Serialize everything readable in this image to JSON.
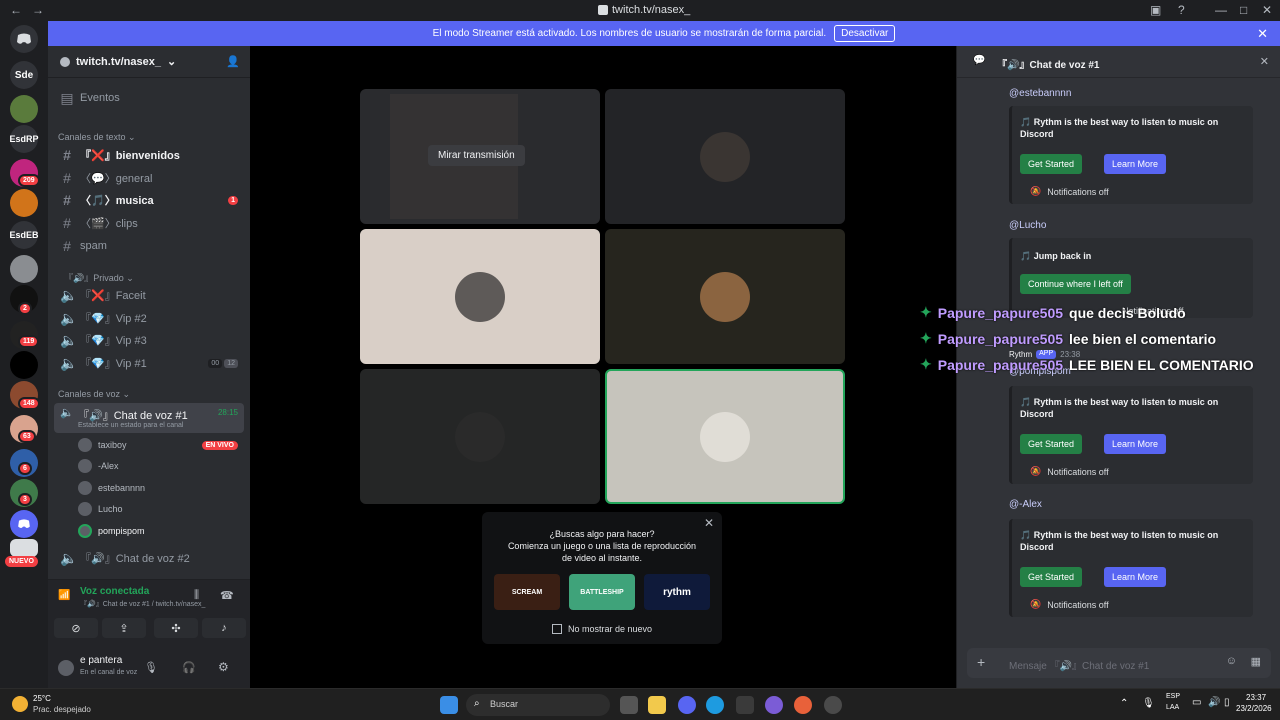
{
  "browser": {
    "title": "twitch.tv/nasex_"
  },
  "guilds": {
    "sde": "Sde",
    "esdrp": "EsdRP",
    "esdeb": "EsdEB",
    "badges": [
      "209",
      "2",
      "119",
      "148",
      "63",
      "6",
      "3"
    ],
    "new_label": "NUEVO"
  },
  "banner": {
    "text": "El modo Streamer está activado. Los nombres de usuario se mostrarán de forma parcial.",
    "button": "Desactivar"
  },
  "server": {
    "name": "twitch.tv/nasex_"
  },
  "sidebar": {
    "events": "Eventos",
    "text_category": "Canales de texto",
    "text_channels": [
      {
        "label": "『❌』bienvenidos"
      },
      {
        "label": "〈💬〉general"
      },
      {
        "label": "〈🎵〉musica",
        "badge": "1"
      },
      {
        "label": "〈🎬〉clips"
      },
      {
        "label": "spam"
      }
    ],
    "private_category": "『🔊』Privado",
    "private_channels": [
      "『❌』Faceit",
      "『💎』Vip #2",
      "『💎』Vip #3",
      "『💎』Vip #1"
    ],
    "vip1_counts": [
      "00",
      "12"
    ],
    "voice_category": "Canales de voz",
    "voice_channel": {
      "label": "『🔊』Chat de voz #1",
      "time": "28:15",
      "status": "Establece un estado para el canal"
    },
    "voice_users": [
      {
        "name": "taxiboy",
        "live": "EN VIVO"
      },
      {
        "name": "-Alex"
      },
      {
        "name": "estebannnn"
      },
      {
        "name": "Lucho"
      },
      {
        "name": "pompispom"
      }
    ],
    "voice_channel2": "『🔊』Chat de voz #2",
    "voice_connected": "Voz conectada",
    "voice_location": "『🔊』Chat de voz #1 / twitch.tv/nasex_",
    "user_name": "e pantera",
    "user_status": "En el canal de voz"
  },
  "stage": {
    "watch_button": "Mirar transmisión",
    "popup_title": "¿Buscas algo para hacer?",
    "popup_sub1": "Comienza un juego o una lista de reproducción",
    "popup_sub2": "de video al instante.",
    "popup_games": [
      "SCREAM",
      "BATTLESHIP",
      "rythm"
    ],
    "popup_check": "No mostrar de nuevo"
  },
  "chat": {
    "title": "『🔊』Chat de voz #1",
    "mention1": "@estebannnn",
    "mention2": "@Lucho",
    "mention3": "@pompispom",
    "mention4": "@-Alex",
    "embed_text": "🎵 Rythm is the best way to listen to music on Discord",
    "jump_text": "🎵 Jump back in",
    "get_started": "Get Started",
    "learn_more": "Learn More",
    "continue": "Continue where I left off",
    "notifications_off": "Notifications off",
    "rythm_tag": "Rythm",
    "app_tag": "APP",
    "rythm_time": "23:38",
    "placeholder": "Mensaje 『🔊』Chat de voz #1"
  },
  "overlay": [
    {
      "user": "Papure_papure505",
      "msg": "que decis Boludo"
    },
    {
      "user": "Papure_papure505",
      "msg": "lee bien el comentario"
    },
    {
      "user": "Papure_papure505",
      "msg": "LEE BIEN EL COMENTARIO"
    }
  ],
  "taskbar": {
    "weather_temp": "25°C",
    "weather_desc": "Prac. despejado",
    "search": "Buscar",
    "lang1": "ESP",
    "lang2": "LAA",
    "time": "23:37",
    "date": "23/2/2026"
  }
}
